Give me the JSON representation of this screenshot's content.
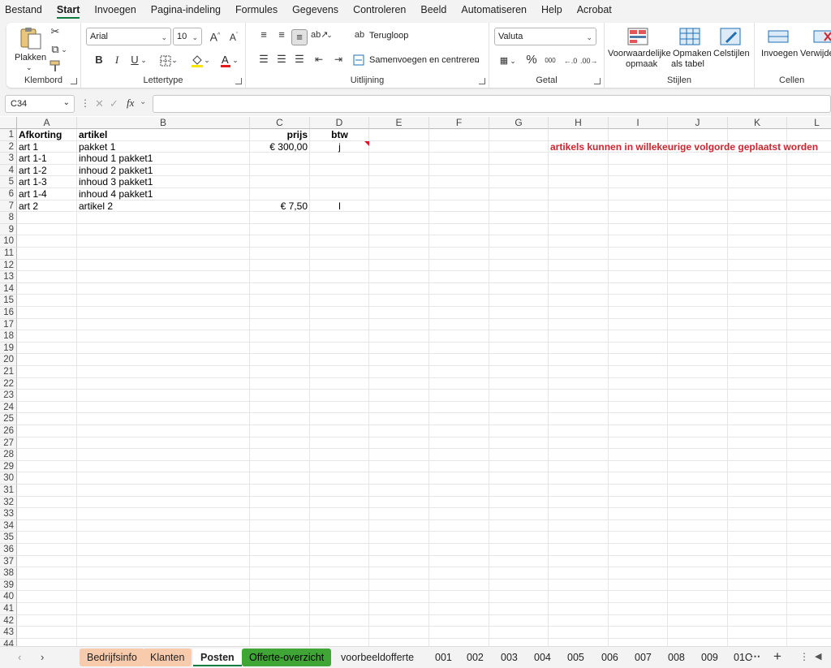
{
  "menu": [
    "Bestand",
    "Start",
    "Invoegen",
    "Pagina-indeling",
    "Formules",
    "Gegevens",
    "Controleren",
    "Beeld",
    "Automatiseren",
    "Help",
    "Acrobat"
  ],
  "ribbon": {
    "paste_label": "Plakken",
    "clipboard_label": "Klembord",
    "font_name": "Arial",
    "font_size": "10",
    "font_group_label": "Lettertype",
    "bold": "B",
    "italic": "I",
    "underline": "U",
    "wrap_text": "Terugloop",
    "merge_center": "Samenvoegen en centreren",
    "alignment_label": "Uitlijning",
    "number_format": "Valuta",
    "number_label": "Getal",
    "percent": "%",
    "thousands": "000",
    "cond_format_1": "Voorwaardelijke",
    "cond_format_2": "opmaak",
    "format_table_1": "Opmaken",
    "format_table_2": "als tabel",
    "cell_styles": "Celstijlen",
    "styles_label": "Stijlen",
    "insert": "Invoegen",
    "delete": "Verwijde",
    "cells_label": "Cellen"
  },
  "formula_bar": {
    "name_box": "C34",
    "fx": "fx",
    "content": ""
  },
  "columns": [
    "A",
    "B",
    "C",
    "D",
    "E",
    "F",
    "G",
    "H",
    "I",
    "J",
    "K",
    "L"
  ],
  "rows": [
    "1",
    "2",
    "3",
    "4",
    "5",
    "6",
    "7",
    "8",
    "9",
    "10",
    "11",
    "12",
    "13",
    "14",
    "15",
    "16",
    "17",
    "18",
    "19",
    "20",
    "21",
    "22",
    "23",
    "24",
    "25",
    "26",
    "27",
    "28",
    "29",
    "30",
    "31",
    "32",
    "33",
    "34",
    "35",
    "36",
    "37",
    "38",
    "39",
    "40",
    "41",
    "42",
    "43",
    "44"
  ],
  "cells": {
    "A1": "Afkorting",
    "B1": "artikel",
    "C1": "prijs",
    "D1": "btw",
    "A2": "art 1",
    "B2": "pakket 1",
    "C2": "€ 300,00",
    "D2": "j",
    "A3": "art 1-1",
    "B3": "inhoud 1 pakket1",
    "A4": "art 1-2",
    "B4": "inhoud 2 pakket1",
    "A5": "art 1-3",
    "B5": "inhoud 3 pakket1",
    "A6": "art 1-4",
    "B6": "inhoud 4 pakket1",
    "A7": "art 2",
    "B7": "artikel 2",
    "C7": "€ 7,50",
    "D7": "l",
    "H2": "artikels kunnen in willekeurige volgorde geplaatst worden"
  },
  "note_color": "#d1242f",
  "sheet_tabs": [
    {
      "label": "Bedrijfsinfo",
      "color": "#f8cbad"
    },
    {
      "label": "Klanten",
      "color": "#f8cbad"
    },
    {
      "label": "Posten",
      "color": "active"
    },
    {
      "label": "Offerte-overzicht",
      "color": "#3fa535"
    },
    {
      "label": "voorbeeldofferte",
      "color": ""
    },
    {
      "label": "001",
      "color": ""
    },
    {
      "label": "002",
      "color": ""
    },
    {
      "label": "003",
      "color": ""
    },
    {
      "label": "004",
      "color": ""
    },
    {
      "label": "005",
      "color": ""
    },
    {
      "label": "006",
      "color": ""
    },
    {
      "label": "007",
      "color": ""
    },
    {
      "label": "008",
      "color": ""
    },
    {
      "label": "009",
      "color": ""
    },
    {
      "label": "01C",
      "color": ""
    }
  ],
  "icons": [
    "scissors-icon",
    "copy-icon",
    "format-painter-icon",
    "grow-font-icon",
    "shrink-font-icon",
    "borders-icon",
    "fill-color-icon",
    "font-color-icon",
    "align-top-icon",
    "align-middle-icon",
    "align-bottom-icon",
    "orientation-icon",
    "align-left-icon",
    "align-center-icon",
    "align-right-icon",
    "decrease-indent-icon",
    "increase-indent-icon",
    "accounting-icon",
    "increase-decimal-icon",
    "decrease-decimal-icon",
    "add-sheet-icon",
    "more-tabs-icon"
  ]
}
